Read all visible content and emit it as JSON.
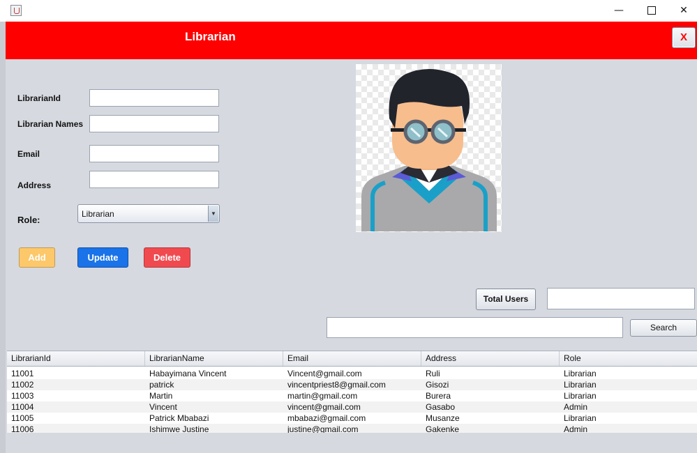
{
  "window": {
    "icons": {
      "app": "java-app-icon",
      "minimize": "minimize-icon",
      "maximize": "maximize-icon",
      "close": "close-icon"
    },
    "minimize_glyph": "—",
    "close_glyph": "✕"
  },
  "header": {
    "title": "Librarian",
    "close_label": "X",
    "background": "#ff0000"
  },
  "form": {
    "labels": {
      "id": "LibrarianId",
      "names": "Librarian Names",
      "email": "Email",
      "address": "Address",
      "role": "Role:"
    },
    "values": {
      "id": "",
      "names": "",
      "email": "",
      "address": ""
    },
    "role_selected": "Librarian"
  },
  "buttons": {
    "add": "Add",
    "update": "Update",
    "delete": "Delete",
    "total_users": "Total Users",
    "search": "Search"
  },
  "colors": {
    "add": "#fdc86a",
    "update": "#1a73e8",
    "delete": "#f04a4f"
  },
  "total_users_value": "",
  "search_value": "",
  "avatar": {
    "icon": "librarian-avatar-icon"
  },
  "table": {
    "columns": [
      "LibrarianId",
      "LibrarianName",
      "Email",
      "Address",
      "Role"
    ],
    "rows": [
      [
        "11001",
        "Habayimana Vincent",
        "Vincent@gmail.com",
        "Ruli",
        "Librarian"
      ],
      [
        "11002",
        "patrick",
        "vincentpriest8@gmail.com",
        "Gisozi",
        "Librarian"
      ],
      [
        "11003",
        "Martin",
        "martin@gmail.com",
        "Burera",
        "Librarian"
      ],
      [
        "11004",
        "Vincent",
        "vincent@gmail.com",
        "Gasabo",
        "Admin"
      ],
      [
        "11005",
        "Patrick Mbabazi",
        "mbabazi@gmail.com",
        "Musanze",
        "Librarian"
      ],
      [
        "11006",
        "Ishimwe Justine",
        "justine@gmail.com",
        "Gakenke",
        "Admin"
      ]
    ]
  }
}
